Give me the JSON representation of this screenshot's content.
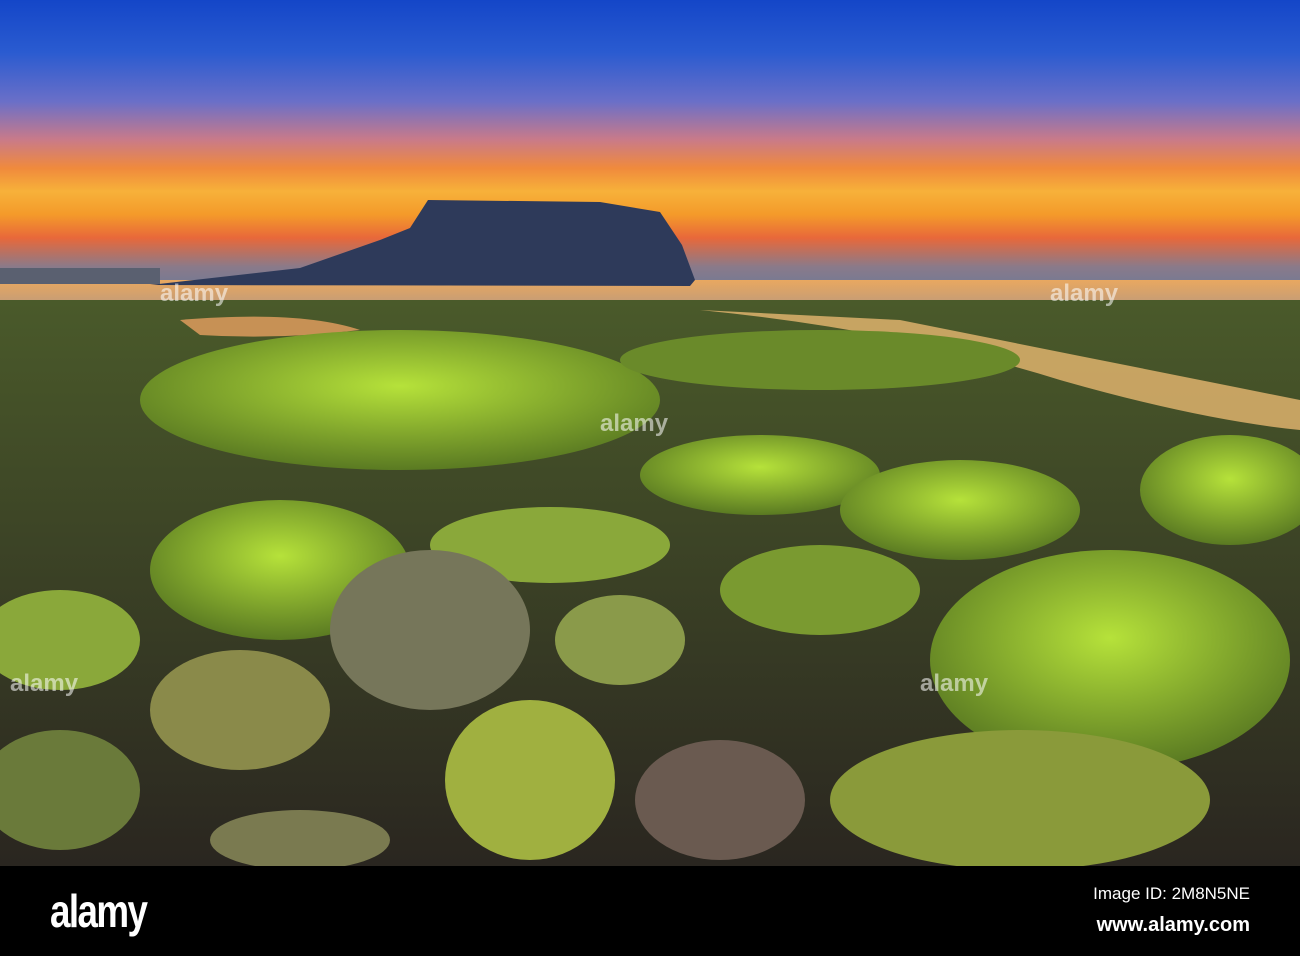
{
  "image": {
    "description_alt": "Mossy rocks at sunrise with Seongsan Ilchulbong"
  },
  "footer": {
    "logo": "alamy",
    "image_id": "Image ID: 2M8N5NE",
    "url": "www.alamy.com"
  },
  "watermark": "alamy",
  "colors": {
    "sky_top": "#1446c8",
    "horizon": "#f7b13a",
    "moss": "#9acd32",
    "footer": "#000000"
  }
}
